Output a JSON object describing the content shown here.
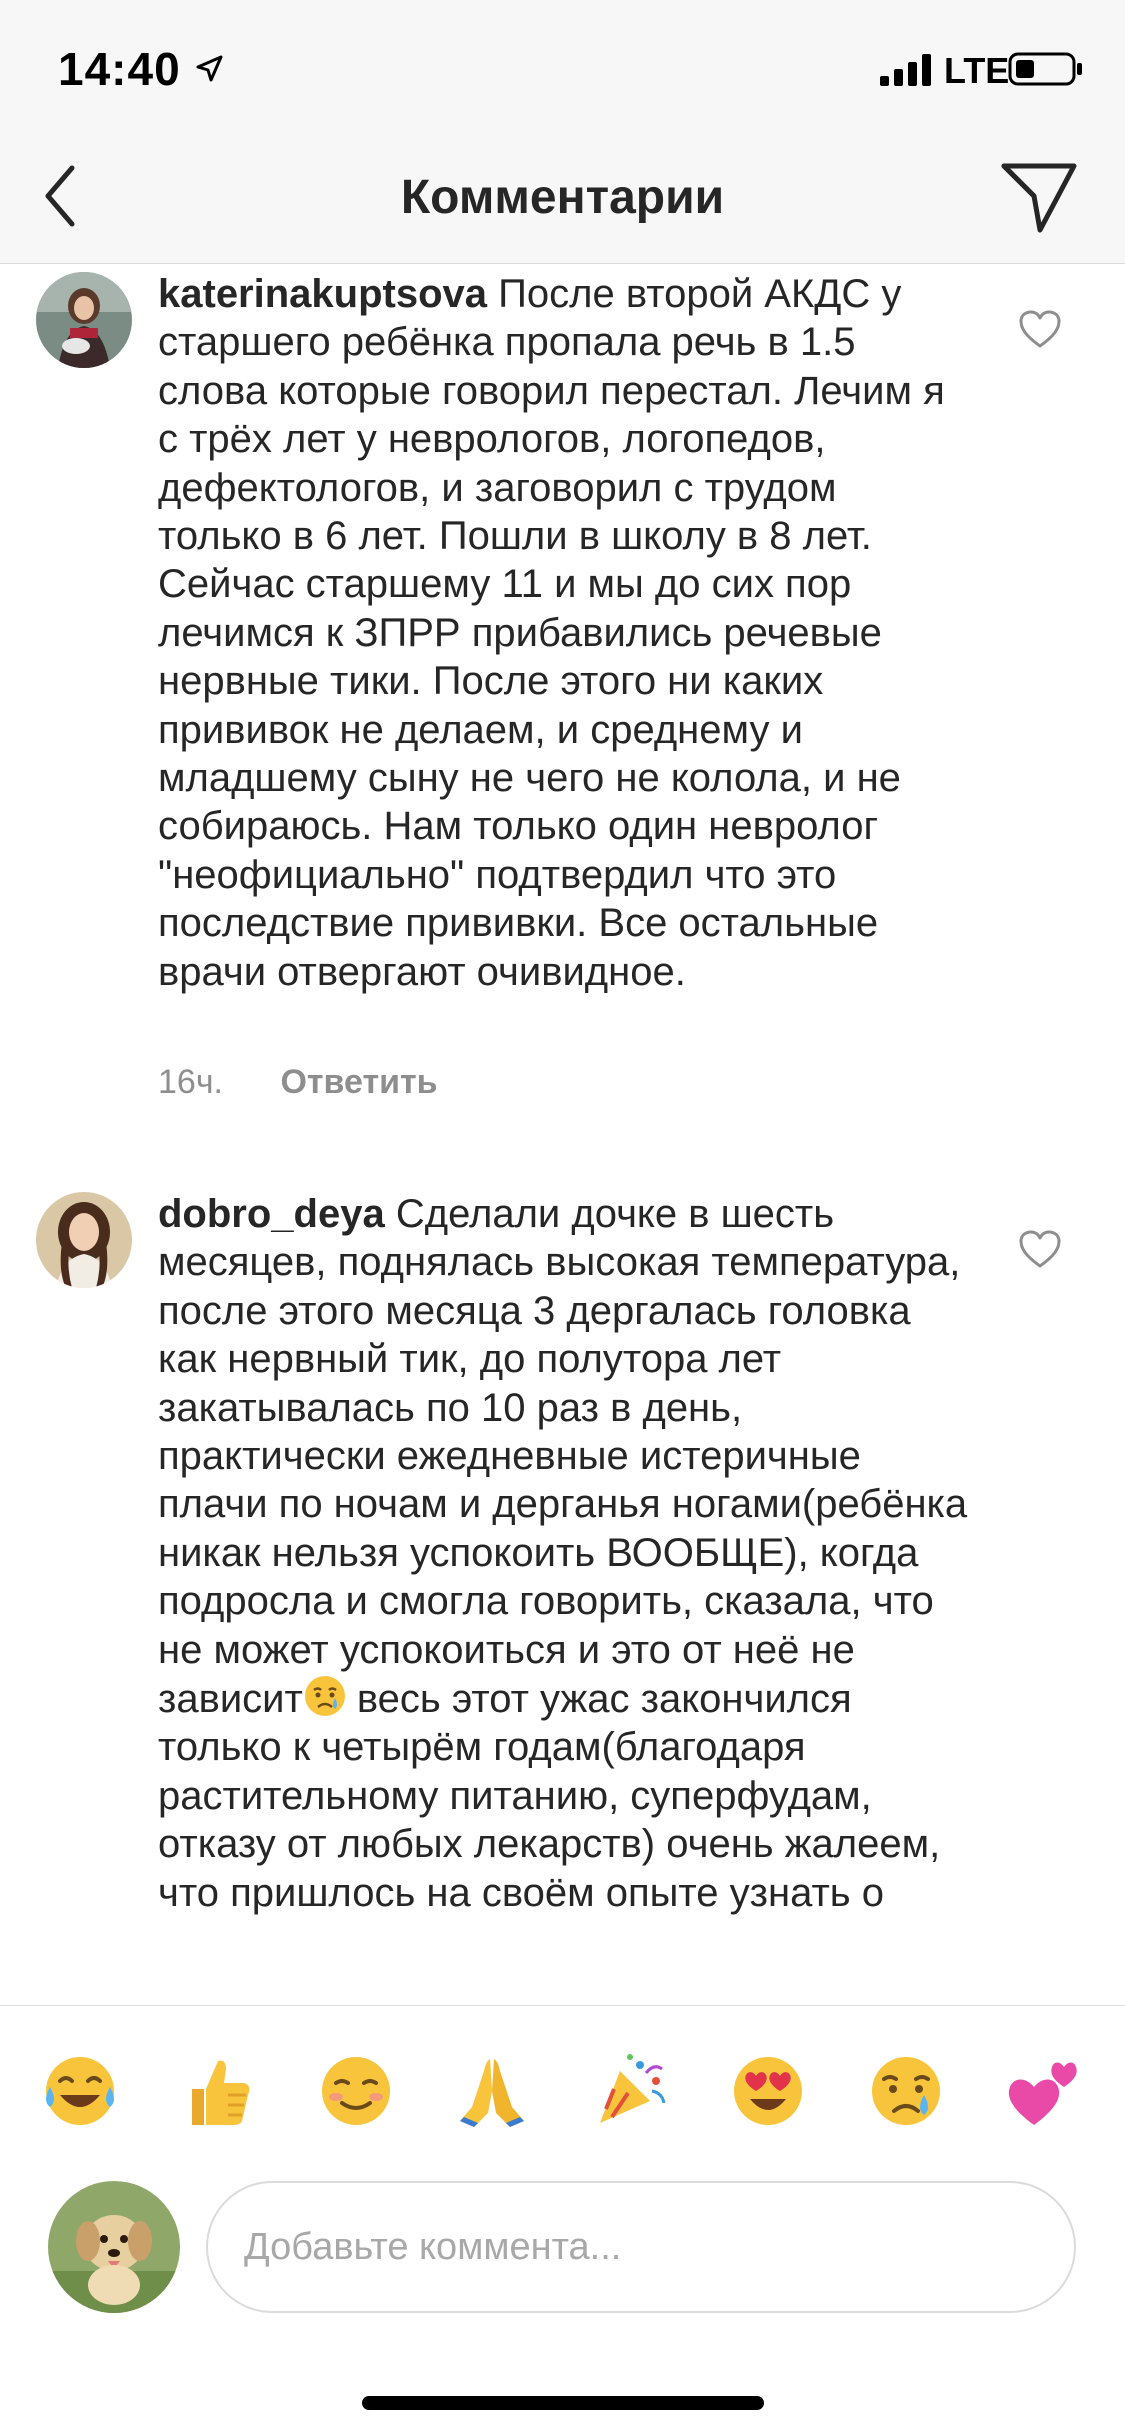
{
  "status_bar": {
    "time": "14:40",
    "network": "LTE"
  },
  "nav": {
    "title": "Комментарии"
  },
  "comments": [
    {
      "username": "katerinakuptsova",
      "text": "После второй АКДС у старшего ребёнка пропала речь в 1.5 слова которые говорил перестал. Лечим я с трёх лет у неврологов, логопедов, дефектологов, и заговорил с трудом только в 6 лет. Пошли в школу в 8 лет. Сейчас старшему 11 и мы до сих пор лечимся к ЗПРР прибавились речевые нервные тики. После этого ни каких прививок не делаем, и среднему и младшему сыну не чего не колола, и не собираюсь. Нам только один невролог \"неофициально\" подтвердил что это последствие прививки. Все остальные врачи отвергают очивидное.",
      "time": "16ч.",
      "reply_label": "Ответить"
    },
    {
      "username": "dobro_deya",
      "text_before_emoji": "Сделали дочке в шесть месяцев, поднялась высокая температура, после этого месяца 3 дергалась головка как нервный тик, до полутора лет закатывалась по 10 раз в день, практически ежедневные истеричные плачи по ночам и дерганья ногами(ребёнка никак нельзя успокоить ВООБЩЕ), когда подросла и смогла говорить, сказала, что не может успокоиться и это от неё не зависит",
      "inline_emoji": "crying-face",
      "text_after_emoji": "весь этот ужас закончился только к четырём годам(благодаря растительному питанию, суперфудам, отказу от любых лекарств) очень жалеем, что пришлось на своём опыте узнать о"
    }
  ],
  "emoji_bar": [
    "face-with-tears-of-joy",
    "thumbs-up",
    "smiling-face",
    "folded-hands",
    "party-popper",
    "heart-eyes",
    "crying-face",
    "two-hearts"
  ],
  "input": {
    "placeholder": "Добавьте коммента..."
  },
  "colors": {
    "background": "#ffffff",
    "bar_background": "#f7f7f7",
    "text": "#262626",
    "secondary_text": "#8e8e8e",
    "border": "#dbdbdb"
  }
}
